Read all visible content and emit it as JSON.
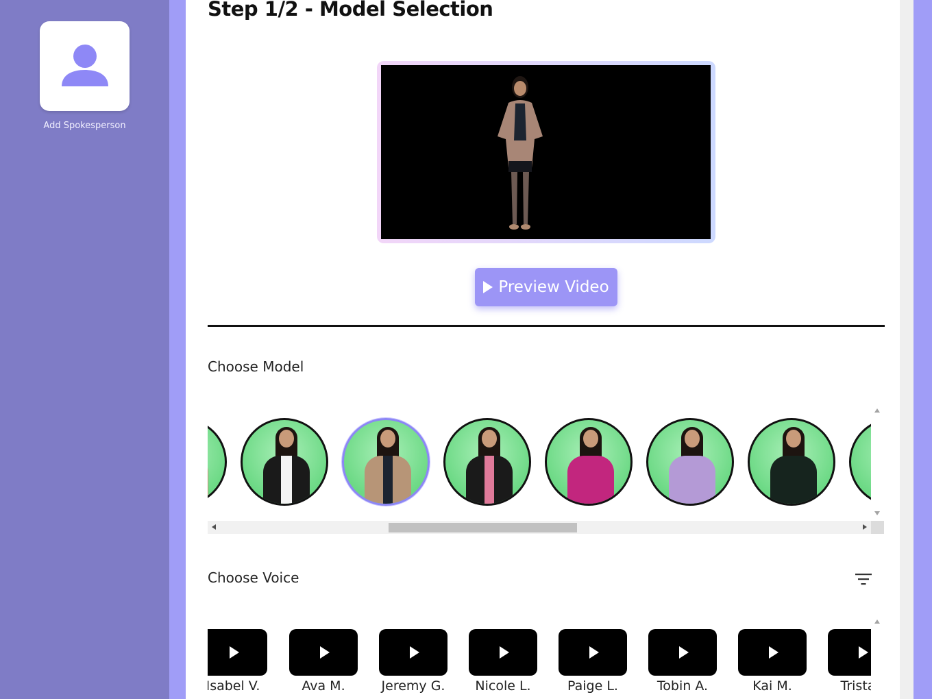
{
  "sidebar": {
    "add_label": "Add Spokesperson"
  },
  "main": {
    "title": "Step 1/2 - Model Selection",
    "preview_button": "Preview Video",
    "choose_model_label": "Choose Model",
    "choose_voice_label": "Choose Voice"
  },
  "models": [
    {
      "outfit": "tan-top",
      "selected": false
    },
    {
      "outfit": "black-blazer-white-shirt",
      "selected": false
    },
    {
      "outfit": "beige-blazer",
      "selected": true
    },
    {
      "outfit": "black-blazer-pink-top",
      "selected": false
    },
    {
      "outfit": "magenta-top",
      "selected": false
    },
    {
      "outfit": "lavender-shirt",
      "selected": false
    },
    {
      "outfit": "black-top-jeans",
      "selected": false
    },
    {
      "outfit": "partial",
      "selected": false
    }
  ],
  "voices": [
    {
      "name": "Isabel V."
    },
    {
      "name": "Ava M."
    },
    {
      "name": "Jeremy G."
    },
    {
      "name": "Nicole L."
    },
    {
      "name": "Paige L."
    },
    {
      "name": "Tobin A."
    },
    {
      "name": "Kai M."
    },
    {
      "name": "Tristan"
    }
  ],
  "colors": {
    "sidebar_bg": "#7f7cc6",
    "accent": "#9c95f6",
    "selected_ring": "#8c86f5"
  },
  "icons": {
    "add_spokesperson": "person-icon",
    "preview": "play-icon",
    "voice_play": "play-icon",
    "filter": "filter-icon"
  }
}
